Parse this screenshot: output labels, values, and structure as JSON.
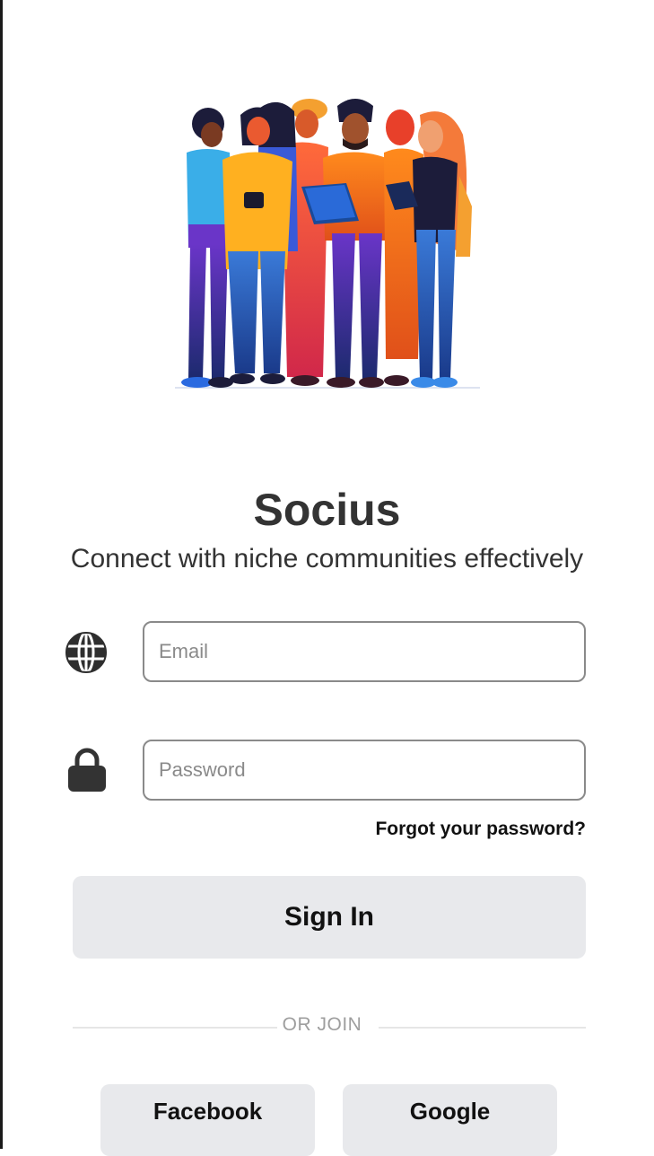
{
  "app": {
    "title": "Socius",
    "tagline": "Connect with niche communities effectively"
  },
  "form": {
    "email_placeholder": "Email",
    "password_placeholder": "Password",
    "forgot_label": "Forgot your password?",
    "signin_label": "Sign In"
  },
  "divider": {
    "label": "OR JOIN"
  },
  "social": {
    "facebook_label": "Facebook",
    "google_label": "Google"
  },
  "icons": {
    "email": "globe-icon",
    "password": "lock-icon"
  },
  "colors": {
    "text": "#333333",
    "button_bg": "#e8e9ec",
    "input_border": "#8a8a8a"
  }
}
